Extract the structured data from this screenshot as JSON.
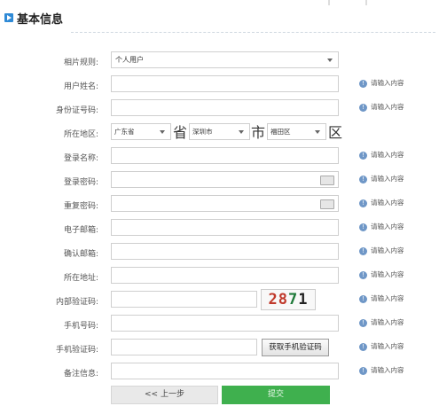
{
  "header": {
    "title": "基本信息"
  },
  "fields": {
    "photo_rule": {
      "label": "相片规则:",
      "value": "个人用户"
    },
    "username": {
      "label": "用户姓名:"
    },
    "id_number": {
      "label": "身份证号码:"
    },
    "region": {
      "label": "所在地区:",
      "province": "广东省",
      "province_suffix": "省",
      "city": "深圳市",
      "city_suffix": "市",
      "district": "福田区",
      "district_suffix": "区"
    },
    "login_name": {
      "label": "登录名称:"
    },
    "login_password": {
      "label": "登录密码:"
    },
    "repeat_password": {
      "label": "重复密码:"
    },
    "email": {
      "label": "电子邮箱:"
    },
    "confirm_email": {
      "label": "确认邮箱:"
    },
    "address": {
      "label": "所在地址:"
    },
    "captcha": {
      "label": "内部验证码:",
      "image_text": [
        "2",
        "8",
        "7",
        "1"
      ]
    },
    "phone": {
      "label": "手机号码:"
    },
    "phone_code": {
      "label": "手机验证码:",
      "button": "获取手机验证码"
    },
    "notes": {
      "label": "备注信息:"
    }
  },
  "hint_text": "请输入内容",
  "buttons": {
    "prev": "<< 上一步",
    "submit": "提交"
  },
  "colors": {
    "accent": "#2f8ad6",
    "submit": "#3fb04e",
    "hint_icon": "#6f97c7"
  }
}
